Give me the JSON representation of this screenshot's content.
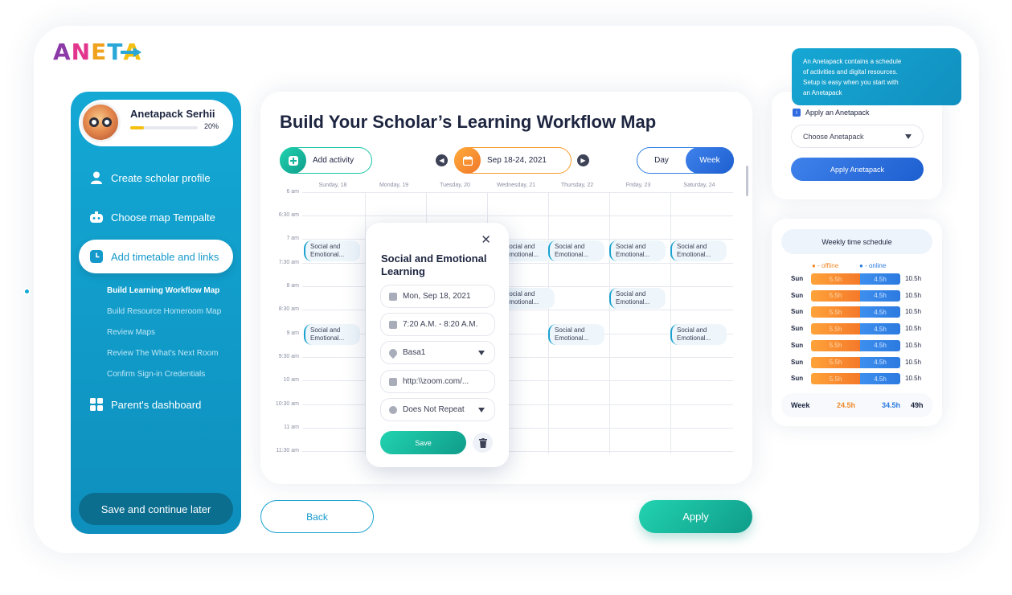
{
  "logo": {
    "letters": [
      "A",
      "N",
      "E",
      "T",
      "A"
    ],
    "colors": [
      "#8c3aa8",
      "#e2358d",
      "#f0a21c",
      "#2aa7d6",
      "#f4c012"
    ]
  },
  "profile": {
    "name": "Anetapack Serhii",
    "progress_pct": "20%",
    "progress_value": 0.2
  },
  "nav": {
    "create_profile": "Create scholar profile",
    "choose_map": "Choose map Tempalte",
    "add_timetable": "Add timetable and links",
    "parents_dashboard": "Parent's dashboard",
    "save_later": "Save and continue later",
    "subitems": [
      "Build Learning Workflow Map",
      "Build Resource Homeroom Map",
      "Review Maps",
      "Review The What's Next Room",
      "Confirm Sign-in Credentials"
    ]
  },
  "main": {
    "title": "Build Your Scholar’s Learning Workflow Map",
    "add_activity": "Add activity",
    "date_range": "Sep 18-24, 2021",
    "view_day": "Day",
    "view_week": "Week",
    "days": [
      "Sunday, 18",
      "Monday, 19",
      "Tuesday, 20",
      "Wednesday, 21",
      "Thursday, 22",
      "Friday, 23",
      "Saturday, 24"
    ],
    "times": [
      "6 am",
      "6:30 am",
      "7 am",
      "7:30 am",
      "8 am",
      "8:30 am",
      "9 am",
      "9:30 am",
      "10 am",
      "10:30 am",
      "11 am",
      "11:30 am"
    ],
    "event_title": "Social and",
    "event_title2": "Emotional..."
  },
  "popup": {
    "title": "Social and Emotional Learning",
    "date": "Mon, Sep 18, 2021",
    "time": "7:20 A.M. - 8:20 A.M.",
    "location": "Basa1",
    "link": "http:\\\\zoom.com/...",
    "repeat": "Does Not Repeat",
    "save": "Save"
  },
  "buttons": {
    "back": "Back",
    "apply": "Apply"
  },
  "anetapack": {
    "tooltip_lines": [
      "An Anetapack contains a schedule",
      "of activities and digital resources.",
      "Setup is easy when you start with",
      "an Anetapack"
    ],
    "label": "Apply an Anetapack",
    "select_placeholder": "Choose Anetapack",
    "apply_button": "Apply Anetapack"
  },
  "schedule": {
    "title": "Weekly time schedule",
    "legend_offline": "- offline",
    "legend_online": "- online",
    "rows": [
      {
        "day": "Sun",
        "offline": "5.5h",
        "online": "4.5h",
        "total": "10.5h"
      },
      {
        "day": "Sun",
        "offline": "5.5h",
        "online": "4.5h",
        "total": "10.5h"
      },
      {
        "day": "Sun",
        "offline": "5.5h",
        "online": "4.5h",
        "total": "10.5h"
      },
      {
        "day": "Sun",
        "offline": "5.5h",
        "online": "4.5h",
        "total": "10.5h"
      },
      {
        "day": "Sun",
        "offline": "5.5h",
        "online": "4.5h",
        "total": "10.5h"
      },
      {
        "day": "Sun",
        "offline": "5.5h",
        "online": "4.5h",
        "total": "10.5h"
      },
      {
        "day": "Sun",
        "offline": "5.5h",
        "online": "4.5h",
        "total": "10.5h"
      }
    ],
    "week_label": "Week",
    "week_offline": "24.5h",
    "week_online": "34.5h",
    "week_total": "49h"
  },
  "colors": {
    "primary_blue": "#14a8d5",
    "teal": "#19c4a6",
    "orange": "#f59a2b",
    "accent_blue": "#2f7fe0"
  }
}
